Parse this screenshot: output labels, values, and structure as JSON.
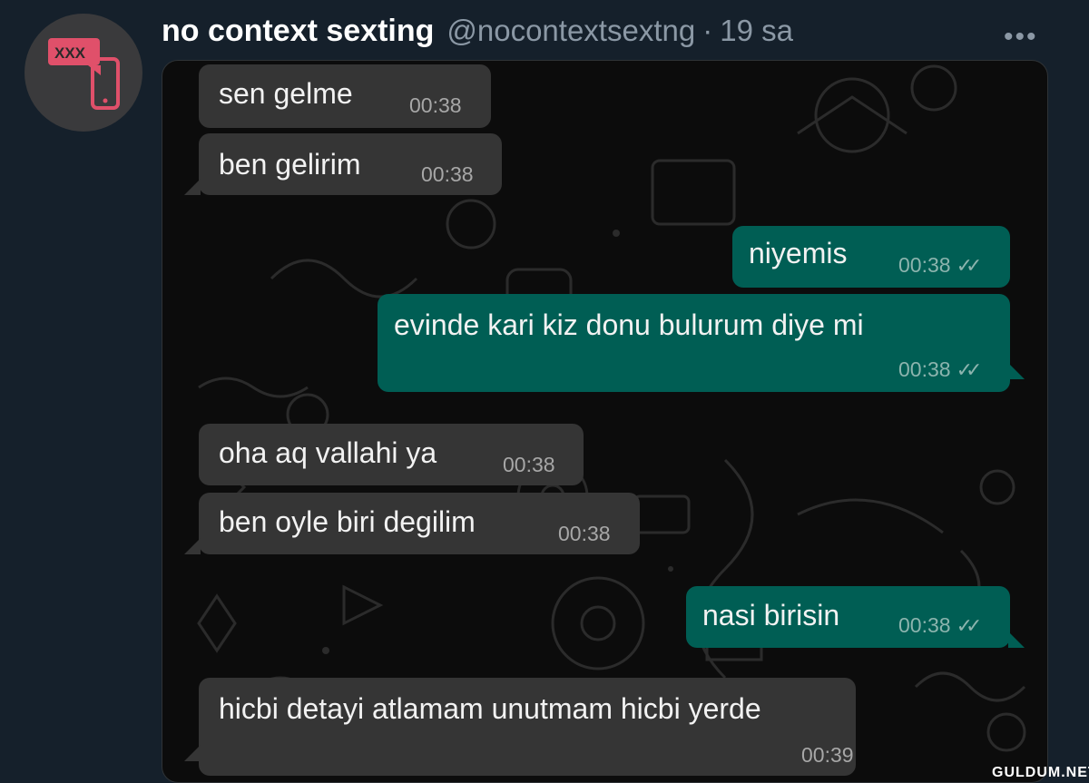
{
  "tweet": {
    "display_name": "no context sexting",
    "handle": "@nocontextsextng",
    "separator": "·",
    "timestamp": "19 sa",
    "more_icon": "more-horizontal-icon",
    "avatar_text": "XXX"
  },
  "chat": {
    "messages": [
      {
        "side": "in",
        "text": "sen gelme",
        "time": "00:38",
        "read": false
      },
      {
        "side": "in",
        "text": "ben gelirim",
        "time": "00:38",
        "read": false
      },
      {
        "side": "out",
        "text": "niyemis",
        "time": "00:38",
        "read": true
      },
      {
        "side": "out",
        "text": "evinde kari kiz donu bulurum diye mi",
        "time": "00:38",
        "read": true
      },
      {
        "side": "in",
        "text": "oha aq vallahi ya",
        "time": "00:38",
        "read": false
      },
      {
        "side": "in",
        "text": "ben oyle biri degilim",
        "time": "00:38",
        "read": false
      },
      {
        "side": "out",
        "text": "nasi birisin",
        "time": "00:38",
        "read": true
      },
      {
        "side": "in",
        "text": "hicbi detayi atlamam unutmam hicbi yerde",
        "time": "00:39",
        "read": false
      }
    ],
    "read_tick": "✓✓"
  },
  "colors": {
    "background": "#15202b",
    "incoming_bubble": "#353535",
    "outgoing_bubble": "#005e54",
    "avatar_accent": "#e0506a"
  },
  "watermark": "GULDUM.NET"
}
